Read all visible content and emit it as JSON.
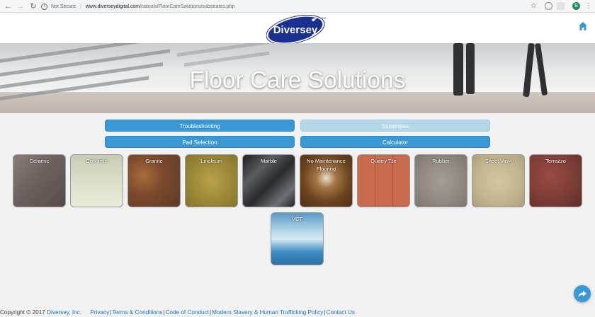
{
  "browser": {
    "security_label": "Not Secure",
    "url_host": "www.diverseydigital.com",
    "url_path": "/natools/FloorCareSolutions/substrates.php",
    "profile_initial": "B"
  },
  "header": {
    "logo_text": "Diversey",
    "trademark": "TM"
  },
  "hero": {
    "title": "Floor Care Solutions"
  },
  "tabs": [
    {
      "label": "Troubleshooting",
      "active": false
    },
    {
      "label": "Substrates",
      "active": true
    },
    {
      "label": "Pad Selection",
      "active": false
    },
    {
      "label": "Calculator",
      "active": false
    }
  ],
  "substrates": [
    {
      "label": "Ceramic"
    },
    {
      "label": "Concrete"
    },
    {
      "label": "Granite"
    },
    {
      "label": "Linoleum"
    },
    {
      "label": "Marble"
    },
    {
      "label": "No Maintenance Flooring"
    },
    {
      "label": "Quarry Tile"
    },
    {
      "label": "Rubber"
    },
    {
      "label": "Sheet Vinyl"
    },
    {
      "label": "Terrazzo"
    },
    {
      "label": "VCT"
    }
  ],
  "footer": {
    "copyright": "Copyright © 2017",
    "company": "Diversey, Inc.",
    "links": [
      "Privacy",
      "Terms & Conditions",
      "Code of Conduct",
      "Modern Slavery & Human Trafficking Policy",
      "Contact Us"
    ]
  },
  "colors": {
    "brand_blue": "#1b2f8f",
    "button_blue": "#3a98d4",
    "button_active": "#b4d8e8"
  }
}
